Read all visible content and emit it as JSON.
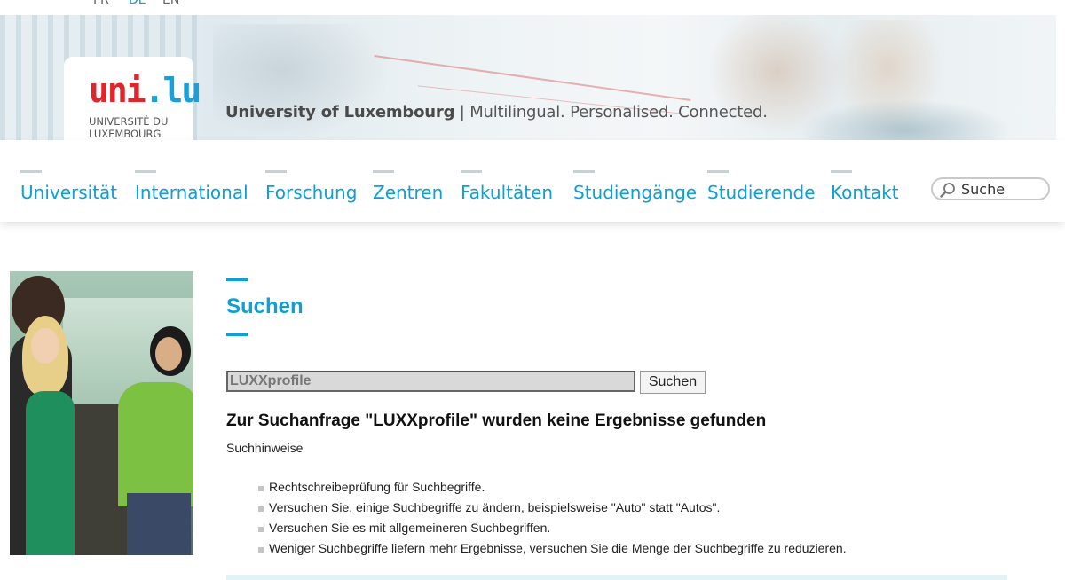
{
  "languages": [
    {
      "label": "FR",
      "active": false
    },
    {
      "label": "DE",
      "active": true
    },
    {
      "label": "EN",
      "active": false
    }
  ],
  "header": {
    "logo": {
      "mark_part1": "uni",
      "mark_part2": ".lu",
      "line1": "UNIVERSITÉ DU",
      "line2": "LUXEMBOURG"
    },
    "tagline_bold": "University of Luxembourg",
    "tagline_sep": " | ",
    "tagline_rest": "Multilingual. Personalised. Connected."
  },
  "nav": {
    "items": [
      {
        "label": "Universität"
      },
      {
        "label": "International"
      },
      {
        "label": "Forschung"
      },
      {
        "label": "Zentren"
      },
      {
        "label": "Fakultäten"
      },
      {
        "label": "Studiengänge"
      },
      {
        "label": "Studierende"
      },
      {
        "label": "Kontakt"
      }
    ],
    "search_placeholder": "Suche"
  },
  "main": {
    "title": "Suchen",
    "query_value": "LUXXprofile",
    "submit_label": "Suchen",
    "result_heading": "Zur Suchanfrage \"LUXXprofile\" wurden keine Ergebnisse gefunden",
    "hints_label": "Suchhinweise",
    "hints": [
      "Rechtschreibeprüfung für Suchbegriffe.",
      "Versuchen Sie, einige Suchbegriffe zu ändern, beispielsweise \"Auto\" statt \"Autos\".",
      "Versuchen Sie es mit allgemeineren Suchbegriffen.",
      "Weniger Suchbegriffe liefern mehr Ergebnisse, versuchen Sie die Menge der Suchbegriffe zu reduzieren."
    ]
  },
  "colors": {
    "accent": "#0aa0d8",
    "logo_red": "#e0262a",
    "logo_blue": "#1a9fd9"
  }
}
